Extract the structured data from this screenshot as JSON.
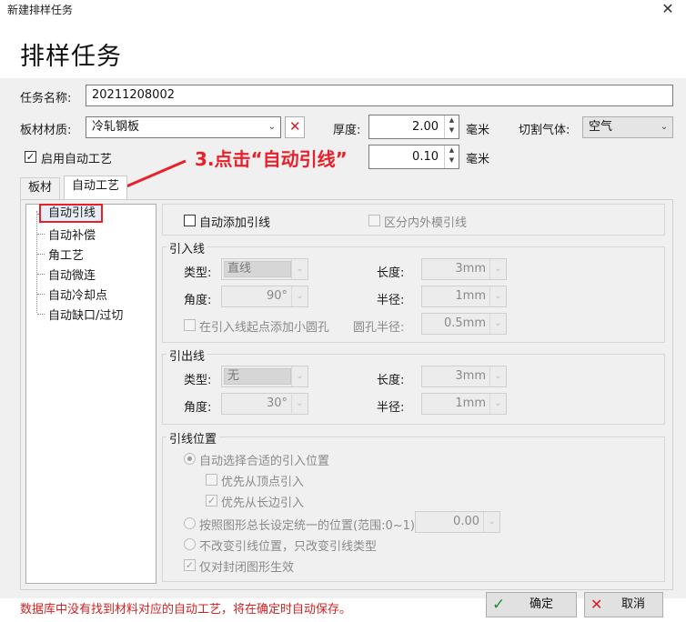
{
  "window": {
    "title": "新建排样任务",
    "close": "✕"
  },
  "header": {
    "title": "排样任务"
  },
  "form": {
    "task_name_label": "任务名称:",
    "task_name_value": "20211208002",
    "material_label": "板材材质:",
    "material_value": "冷轧钢板",
    "thickness_label": "厚度:",
    "thickness_value": "2.00",
    "thickness_unit": "毫米",
    "gas_label": "切割气体:",
    "gas_value": "空气",
    "auto_process_label": "启用自动工艺",
    "auto_process_checked": true,
    "spacing_value": "0.10",
    "spacing_unit": "毫米"
  },
  "annotation": {
    "text": "3.点击“自动引线”",
    "color": "#e8202a"
  },
  "tabs": [
    {
      "label": "板材"
    },
    {
      "label": "自动工艺"
    }
  ],
  "tree": {
    "items": [
      {
        "label": "自动引线"
      },
      {
        "label": "自动补偿"
      },
      {
        "label": "角工艺"
      },
      {
        "label": "自动微连"
      },
      {
        "label": "自动冷却点"
      },
      {
        "label": "自动缺口/过切"
      }
    ]
  },
  "top_options": {
    "auto_add_lead": "自动添加引线",
    "distinguish_inner_outer": "区分内外模引线"
  },
  "lead_in": {
    "title": "引入线",
    "type_label": "类型:",
    "type_value": "直线",
    "length_label": "长度:",
    "length_value": "3mm",
    "angle_label": "角度:",
    "angle_value": "90°",
    "radius_label": "半径:",
    "radius_value": "1mm",
    "hole_option": "在引入线起点添加小圆孔",
    "hole_radius_label": "圆孔半径:",
    "hole_radius_value": "0.5mm"
  },
  "lead_out": {
    "title": "引出线",
    "type_label": "类型:",
    "type_value": "无",
    "length_label": "长度:",
    "length_value": "3mm",
    "angle_label": "角度:",
    "angle_value": "30°",
    "radius_label": "半径:",
    "radius_value": "1mm"
  },
  "lead_position": {
    "title": "引线位置",
    "auto_select": "自动选择合适的引入位置",
    "prefer_vertex": "优先从顶点引入",
    "prefer_long_edge": "优先从长边引入",
    "by_length": "按照图形总长设定统一的位置(范围:0~1)",
    "by_length_value": "0.00",
    "keep_position": "不改变引线位置，只改变引线类型",
    "closed_only": "仅对封闭图形生效"
  },
  "footer": {
    "message": "数据库中没有找到材料对应的自动工艺，将在确定时自动保存。",
    "ok_label": "确定",
    "cancel_label": "取消",
    "ok_icon_color": "#1f8f2a",
    "cancel_icon_color": "#d42020"
  },
  "glyphs": {
    "check": "✓",
    "cross": "✕",
    "chevron": "⌄"
  }
}
